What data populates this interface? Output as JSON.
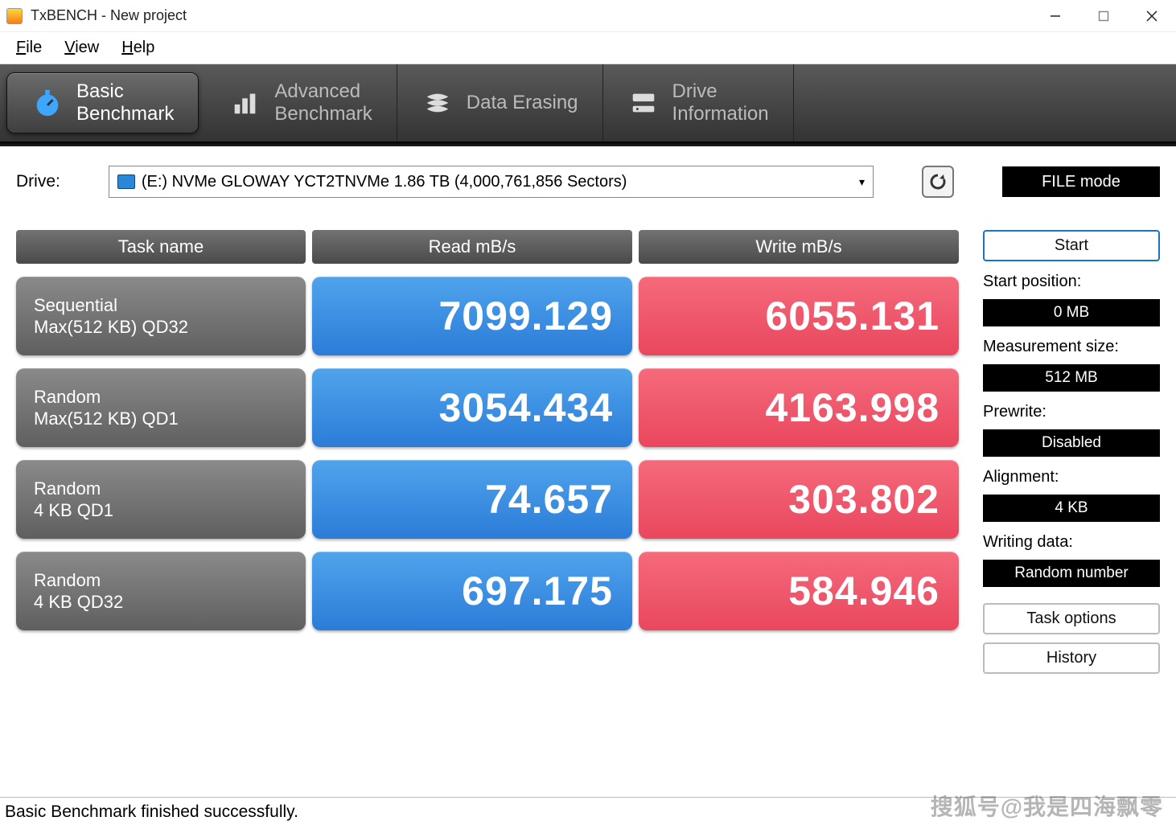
{
  "window": {
    "title": "TxBENCH - New project"
  },
  "menu": {
    "file": "File",
    "view": "View",
    "help": "Help"
  },
  "tabs": {
    "basic1": "Basic",
    "basic2": "Benchmark",
    "adv1": "Advanced",
    "adv2": "Benchmark",
    "erase": "Data Erasing",
    "drive1": "Drive",
    "drive2": "Information"
  },
  "drive": {
    "label": "Drive:",
    "selected": "(E:) NVMe GLOWAY YCT2TNVMe  1.86 TB (4,000,761,856 Sectors)",
    "mode_button": "FILE mode"
  },
  "headers": {
    "task": "Task name",
    "read": "Read mB/s",
    "write": "Write mB/s"
  },
  "rows": [
    {
      "task1": "Sequential",
      "task2": "Max(512 KB) QD32",
      "read": "7099.129",
      "write": "6055.131"
    },
    {
      "task1": "Random",
      "task2": "Max(512 KB) QD1",
      "read": "3054.434",
      "write": "4163.998"
    },
    {
      "task1": "Random",
      "task2": "4 KB QD1",
      "read": "74.657",
      "write": "303.802"
    },
    {
      "task1": "Random",
      "task2": "4 KB QD32",
      "read": "697.175",
      "write": "584.946"
    }
  ],
  "side": {
    "start": "Start",
    "start_pos_label": "Start position:",
    "start_pos_value": "0 MB",
    "meas_size_label": "Measurement size:",
    "meas_size_value": "512 MB",
    "prewrite_label": "Prewrite:",
    "prewrite_value": "Disabled",
    "align_label": "Alignment:",
    "align_value": "4 KB",
    "writing_label": "Writing data:",
    "writing_value": "Random number",
    "task_options": "Task options",
    "history": "History"
  },
  "status": "Basic Benchmark finished successfully.",
  "watermark": "搜狐号@我是四海飘零"
}
